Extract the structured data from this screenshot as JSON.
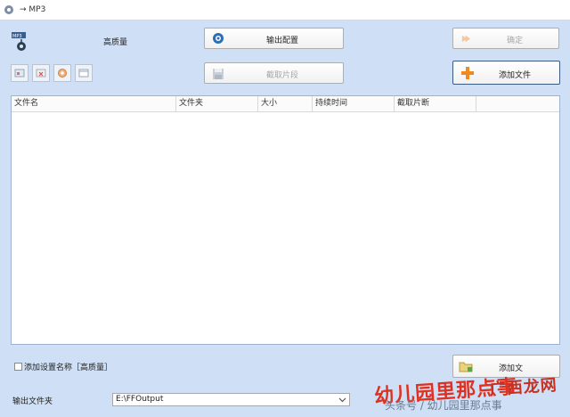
{
  "window": {
    "title": "→ MP3"
  },
  "preset": {
    "name": "高质量"
  },
  "buttons": {
    "output_config": "输出配置",
    "confirm": "确定",
    "clip": "截取片段",
    "add_file": "添加文件",
    "add_folder": "添加文"
  },
  "table": {
    "columns": [
      "文件名",
      "文件夹",
      "大小",
      "持续时间",
      "截取片断"
    ]
  },
  "options": {
    "add_setting_name_label": "添加设置名称［高质量］",
    "add_setting_name_checked": false
  },
  "output": {
    "folder_label": "输出文件夹",
    "folder_value": "E:\\FFOutput"
  },
  "watermark": {
    "main": "幼儿园里那点事",
    "sub": "头条号 / 幼儿园里那点事",
    "site": "广西龙网"
  },
  "colors": {
    "background": "#cfe0f6",
    "accent_orange": "#f08a20"
  }
}
